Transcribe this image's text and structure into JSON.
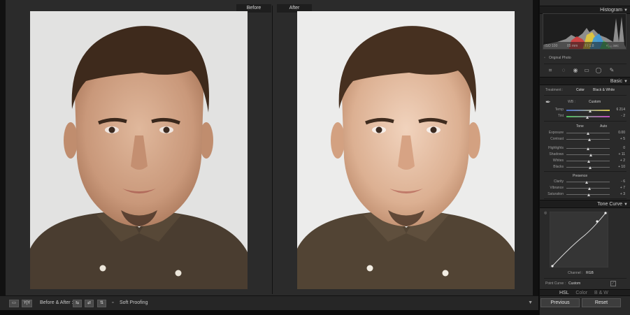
{
  "view": {
    "before_label": "Before",
    "after_label": "After"
  },
  "toolbar": {
    "view_mode_label": "Y|Y",
    "compare_label": "Before & After :",
    "soft_proofing_label": "Soft Proofing"
  },
  "histogram": {
    "title": "Histogram",
    "readout": [
      "ISO 100",
      "85 mm",
      "f / 1.8",
      "¹⁄₂₀₀ sec"
    ],
    "original_photo_label": "Original Photo"
  },
  "basic": {
    "title": "Basic",
    "treatment_label": "Treatment :",
    "color_label": "Color",
    "bw_label": "Black & White",
    "wb_label": "WB :",
    "wb_value": "Custom",
    "temp_label": "Temp",
    "temp_value": "6 214",
    "tint_label": "Tint",
    "tint_value": "- 2",
    "tone_label": "Tone",
    "auto_label": "Auto",
    "tone_sliders": [
      {
        "label": "Exposure",
        "value": "0.00",
        "level": 0.5
      },
      {
        "label": "Contrast",
        "value": "+ 5",
        "level": 0.53
      }
    ],
    "range_sliders": [
      {
        "label": "Highlights",
        "value": "0",
        "level": 0.5
      },
      {
        "label": "Shadows",
        "value": "+ 11",
        "level": 0.56
      },
      {
        "label": "Whites",
        "value": "+ 2",
        "level": 0.52
      },
      {
        "label": "Blacks",
        "value": "+ 10",
        "level": 0.55
      }
    ],
    "presence_label": "Presence",
    "presence_sliders": [
      {
        "label": "Clarity",
        "value": "- 6",
        "level": 0.47
      },
      {
        "label": "Vibrance",
        "value": "+ 7",
        "level": 0.54
      },
      {
        "label": "Saturation",
        "value": "+ 3",
        "level": 0.52
      }
    ]
  },
  "tone_curve": {
    "title": "Tone Curve",
    "channel_label": "Channel :",
    "channel_value": "RGB",
    "point_curve_label": "Point Curve :",
    "point_curve_value": "Custom"
  },
  "hsl": {
    "items": [
      "HSL",
      "Color",
      "B & W"
    ]
  },
  "buttons": {
    "previous": "Previous",
    "reset": "Reset"
  },
  "colors": {
    "panel_bg": "#2a2a2a",
    "header_bg": "#1d1d1d",
    "view_bg": "#2b2b2b",
    "shirt": "#4a3d30",
    "hair": "#3e2a1c"
  }
}
